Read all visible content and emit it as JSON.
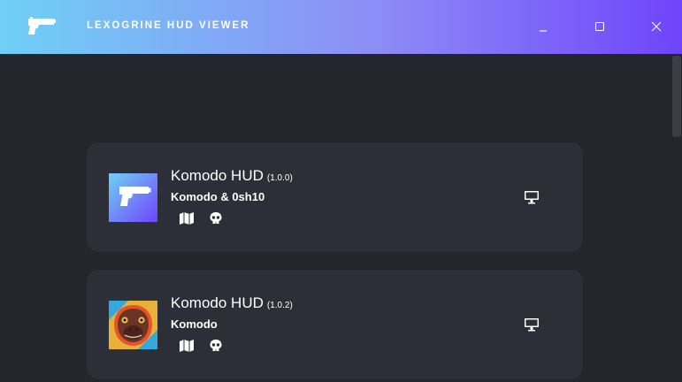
{
  "window": {
    "title": "LEXOGRINE HUD VIEWER",
    "controls": [
      "minimize",
      "maximize",
      "close"
    ]
  },
  "huds": [
    {
      "name": "Komodo HUD",
      "version": "(1.0.0)",
      "author": "Komodo & 0sh10",
      "thumbnail": "pistol-logo",
      "features": [
        "map-icon",
        "skull-icon"
      ],
      "action_icon": "monitor-icon"
    },
    {
      "name": "Komodo HUD",
      "version": "(1.0.2)",
      "author": "Komodo",
      "thumbnail": "komodo-dragon-logo",
      "features": [
        "map-icon",
        "skull-icon"
      ],
      "action_icon": "monitor-icon"
    }
  ],
  "colors": {
    "titlebar_gradient": [
      "#6fd0f5",
      "#8d8df6",
      "#7044fb"
    ],
    "background": "#23262d",
    "card": "#2c2f38",
    "text": "#ffffff"
  }
}
